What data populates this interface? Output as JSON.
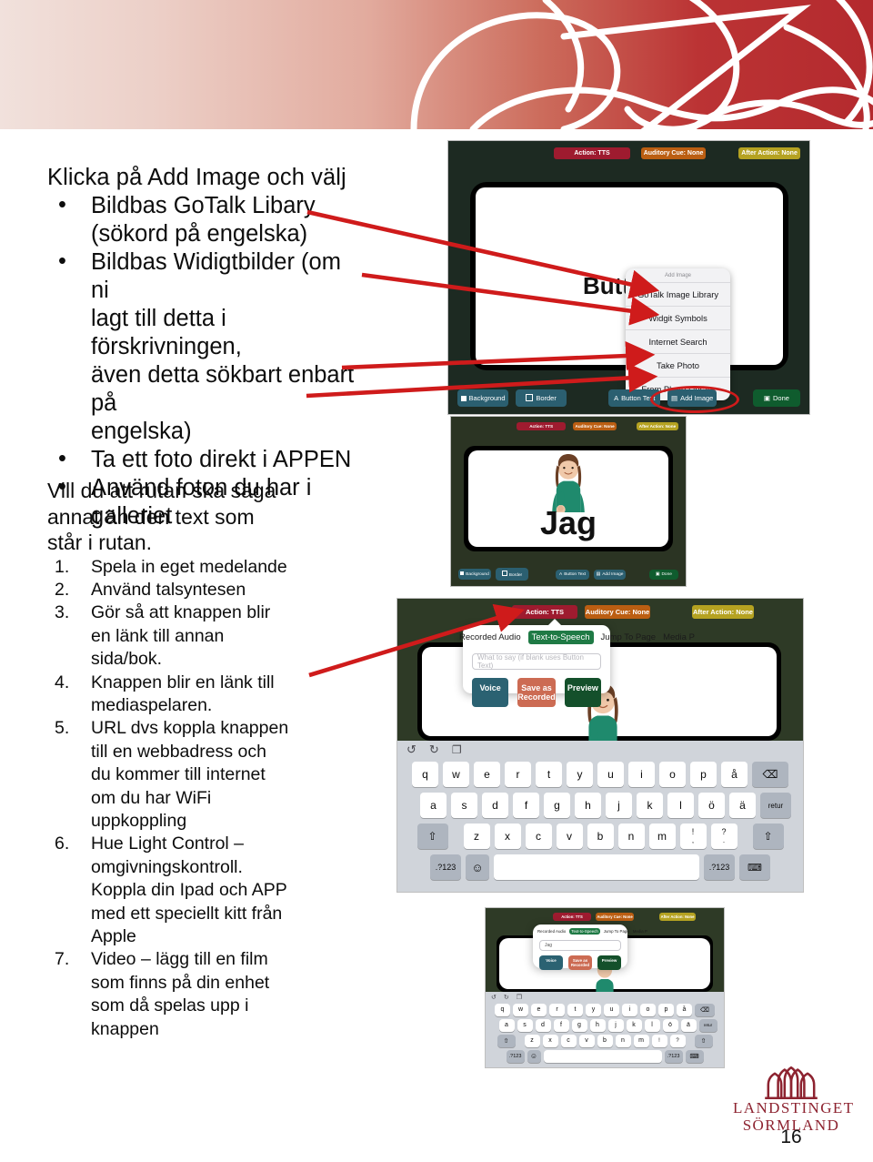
{
  "document": {
    "page_number": "16",
    "logo": {
      "line1": "LANDSTINGET",
      "line2": "SÖRMLAND",
      "color": "#8d2330"
    }
  },
  "content": {
    "lead": "Klicka på Add Image och välj",
    "bullets": [
      "Bildbas GoTalk Libary (sökord på engelska)",
      "Bildbas Widigtbilder (om ni lagt till detta i förskrivningen, även detta sökbart enbart på engelska)",
      "Ta ett foto direkt i APPEN",
      "Använd foton du har i galleriet"
    ],
    "bullet_lines": [
      [
        "Bildbas GoTalk Libary",
        "(sökord på engelska)"
      ],
      [
        "Bildbas Widigtbilder (om ni",
        "lagt till detta i förskrivningen,",
        "även detta sökbart enbart på",
        "engelska)"
      ],
      [
        "Ta ett foto direkt i APPEN"
      ],
      [
        "Använd foton du har i",
        "galleriet"
      ]
    ],
    "heading2_lines": [
      "Vill du att rutan ska säga",
      "annat än den text som",
      "står i rutan."
    ],
    "numbered": [
      {
        "n": "1.",
        "lines": [
          "Spela in eget medelande"
        ]
      },
      {
        "n": "2.",
        "lines": [
          "Använd talsyntesen"
        ]
      },
      {
        "n": "3.",
        "lines": [
          "Gör så att knappen blir",
          "en länk till annan",
          "sida/bok."
        ]
      },
      {
        "n": "4.",
        "lines": [
          "Knappen blir en länk till",
          "mediaspelaren."
        ]
      },
      {
        "n": "5.",
        "lines": [
          "URL dvs koppla knappen",
          "till en webbadress och",
          "du kommer till internet",
          "om du har WiFi",
          "uppkoppling"
        ]
      },
      {
        "n": "6.",
        "lines": [
          "Hue Light Control –",
          "omgivningskontroll.",
          "Koppla din Ipad och APP",
          "med ett speciellt kitt från",
          "Apple"
        ]
      },
      {
        "n": "7.",
        "lines": [
          "Video – lägg till en film",
          "som finns på din enhet",
          "som då spelas upp i",
          "knappen"
        ]
      }
    ]
  },
  "screenshot_add_image": {
    "topbar": {
      "action": "Action: TTS",
      "auditory_cue": "Auditory Cue: None",
      "after_action": "After Action: None"
    },
    "canvas_text": "Butt",
    "dropdown": {
      "title": "Add Image",
      "items": [
        "GoTalk Image Library",
        "Widgit Symbols",
        "Internet Search",
        "Take Photo",
        "From Photo Library"
      ]
    },
    "bottombar": {
      "background": "Background",
      "border": "Border",
      "button_text": "Button Text",
      "add_image": "Add Image",
      "done": "Done"
    },
    "colors": {
      "action": "#9e1b2f",
      "cue": "#bb5e12",
      "after": "#b5a221",
      "teal": "#2b5f70",
      "done": "#0f5c2e",
      "highlight": "#cf1b1b"
    }
  },
  "screenshot_jag": {
    "topbar": {
      "action": "Action: TTS",
      "auditory_cue": "Auditory Cue: None",
      "after_action": "After Action: None"
    },
    "button_label": "Jag",
    "bottombar": {
      "background": "Background",
      "border": "Border",
      "button_text": "Button Text",
      "add_image": "Add Image",
      "done": "Done"
    }
  },
  "screenshot_tts": {
    "topbar": {
      "action": "Action: TTS",
      "auditory_cue": "Auditory Cue: None",
      "after_action": "After Action: None"
    },
    "popup": {
      "tabs": [
        "Recorded Audio",
        "Text-to-Speech",
        "Jump To Page",
        "Media P"
      ],
      "active_tab": "Text-to-Speech",
      "input_placeholder": "What to say (if blank uses Button Text)",
      "input_value": "",
      "buttons": [
        "Voice",
        "Save as Recorded",
        "Preview"
      ]
    },
    "keyboard": {
      "tools": [
        "undo-icon",
        "redo-icon",
        "paste-icon"
      ],
      "row1": [
        "q",
        "w",
        "e",
        "r",
        "t",
        "y",
        "u",
        "i",
        "o",
        "p",
        "å"
      ],
      "row1_end": "⌫",
      "row2": [
        "a",
        "s",
        "d",
        "f",
        "g",
        "h",
        "j",
        "k",
        "l",
        "ö",
        "ä"
      ],
      "row2_end": "retur",
      "row3": [
        "z",
        "x",
        "c",
        "v",
        "b",
        "n",
        "m",
        "!\n,",
        "?\n."
      ],
      "shift": "⇧",
      "num_left": ".?123",
      "emoji": "☺",
      "space": "",
      "num_right": ".?123",
      "hide": "⌨"
    }
  },
  "screenshot_tts_small": {
    "topbar": {
      "action": "Action: TTS",
      "auditory_cue": "Auditory Cue: None",
      "after_action": "After Action: None"
    },
    "popup": {
      "tabs": [
        "Recorded Audio",
        "Text-to-Speech",
        "Jump To Page",
        "Media P"
      ],
      "active_tab": "Text-to-Speech",
      "input_value": "Jag",
      "buttons": [
        "Voice",
        "Save as Recorded",
        "Preview"
      ]
    },
    "keyboard": {
      "row1": [
        "q",
        "w",
        "e",
        "r",
        "t",
        "y",
        "u",
        "i",
        "o",
        "p",
        "å"
      ],
      "row2": [
        "a",
        "s",
        "d",
        "f",
        "g",
        "h",
        "j",
        "k",
        "l",
        "ö",
        "ä"
      ],
      "row3": [
        "z",
        "x",
        "c",
        "v",
        "b",
        "n",
        "m",
        "!",
        "?"
      ],
      "num_left": ".?123",
      "num_right": ".?123"
    }
  }
}
